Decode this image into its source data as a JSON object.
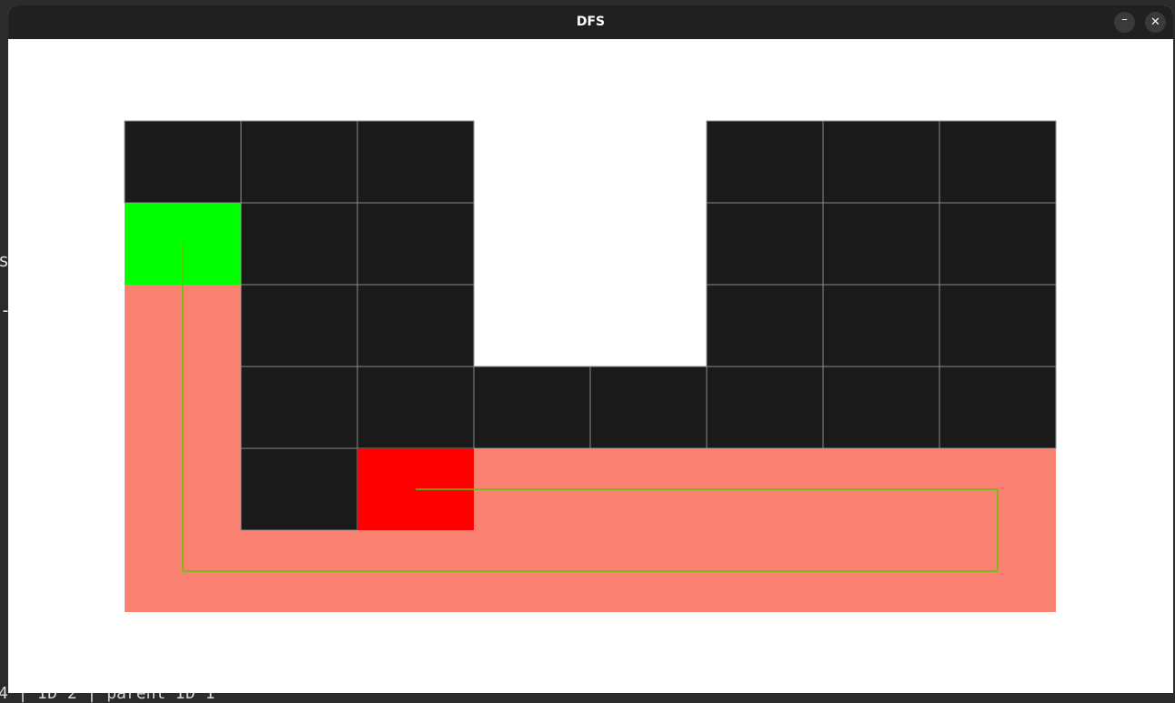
{
  "window": {
    "title": "DFS",
    "minimize_glyph": "–",
    "close_glyph": "✕"
  },
  "background_terminal": {
    "visible_glyphs": [
      "s",
      "-",
      "4 | ID 2 | parent ID 1"
    ]
  },
  "maze": {
    "rows": 6,
    "cols": 8,
    "legend_colors": {
      "wall": "#1a1a1a",
      "open": "#ffffff",
      "start": "#00ff00",
      "goal": "#ff0000",
      "explored": "#fa8072",
      "path": "#55cc00",
      "grid_line": "#8a8a8a"
    },
    "grid": [
      "###..###",
      "S##..###",
      "E##..###",
      "E#######",
      "E#GEEEEE",
      "EEEEEEEE"
    ],
    "start": [
      1,
      0
    ],
    "goal": [
      4,
      2
    ],
    "solution_path": [
      [
        1,
        0
      ],
      [
        2,
        0
      ],
      [
        3,
        0
      ],
      [
        4,
        0
      ],
      [
        5,
        0
      ],
      [
        5,
        1
      ],
      [
        5,
        2
      ],
      [
        5,
        3
      ],
      [
        5,
        4
      ],
      [
        5,
        5
      ],
      [
        5,
        6
      ],
      [
        5,
        7
      ],
      [
        4,
        7
      ],
      [
        4,
        6
      ],
      [
        4,
        5
      ],
      [
        4,
        4
      ],
      [
        4,
        3
      ],
      [
        4,
        2
      ]
    ]
  }
}
